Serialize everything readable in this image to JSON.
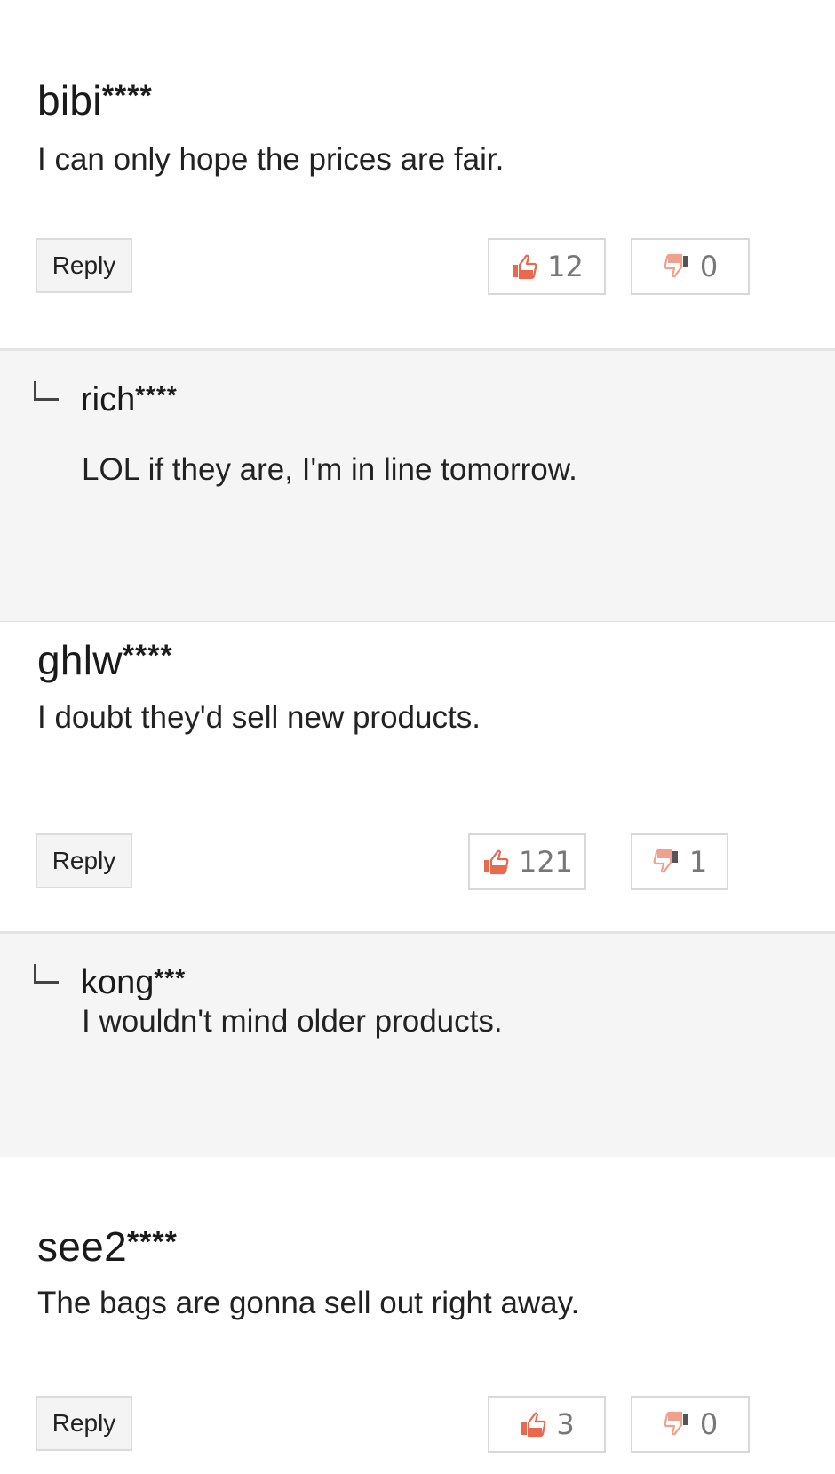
{
  "comments": [
    {
      "author": "bibi",
      "masked": "****",
      "text": "I can only hope the prices are fair.",
      "reply_label": "Reply",
      "likes": "12",
      "dislikes": "0",
      "reply": {
        "author": "rich",
        "masked": "****",
        "text": "LOL if they are, I'm in line tomorrow."
      }
    },
    {
      "author": "ghlw",
      "masked": "****",
      "text": "I doubt they'd sell new products.",
      "reply_label": "Reply",
      "likes": "121",
      "dislikes": "1",
      "reply": {
        "author": "kong",
        "masked": "***",
        "text": "I wouldn't mind older products."
      }
    },
    {
      "author": "see2",
      "masked": "****",
      "text": "The bags are gonna sell out right away.",
      "reply_label": "Reply",
      "likes": "3",
      "dislikes": "0"
    }
  ],
  "icons": {
    "like": "thumbs-up-icon",
    "dislike": "thumbs-down-icon",
    "reply_marker": "reply-arrow-icon"
  },
  "colors": {
    "like_accent": "#e8694e",
    "dislike_accent": "#f0a08c",
    "reply_background": "#f5f5f5",
    "border": "#d8d8d8"
  }
}
